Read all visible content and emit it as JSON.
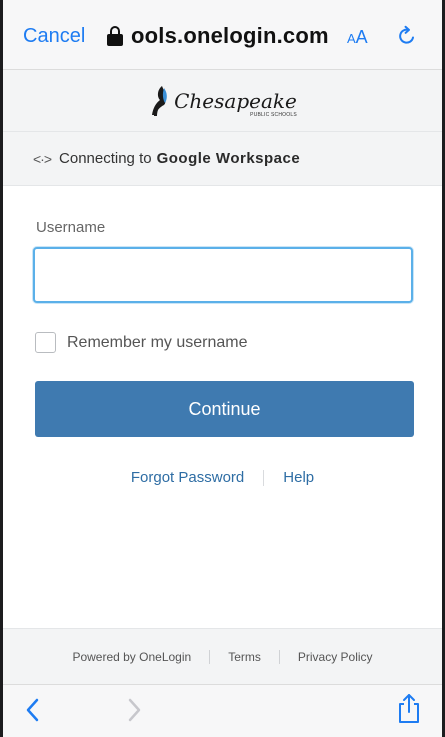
{
  "browser": {
    "cancel_label": "Cancel",
    "url": "ools.onelogin.com",
    "aa_small": "A",
    "aa_big": "A"
  },
  "brand": {
    "logo_text": "Chesapeake",
    "logo_subtext": "PUBLIC SCHOOLS"
  },
  "connect": {
    "prefix": "Connecting to",
    "app_name": "Google Workspace"
  },
  "form": {
    "username_label": "Username",
    "username_value": "",
    "remember_label": "Remember my username",
    "remember_checked": false,
    "continue_label": "Continue"
  },
  "links": {
    "forgot_password": "Forgot Password",
    "help": "Help"
  },
  "footer": {
    "powered_by": "Powered by OneLogin",
    "terms": "Terms",
    "privacy": "Privacy Policy"
  },
  "colors": {
    "accent": "#1e7cf2",
    "primary_button": "#3f7ab0",
    "link": "#2e6da4",
    "input_focus": "#5bb0e9"
  },
  "icons": [
    "lock-icon",
    "reload-icon",
    "logo-mark-icon",
    "connect-arrows-icon",
    "back-icon",
    "forward-icon",
    "share-icon"
  ]
}
